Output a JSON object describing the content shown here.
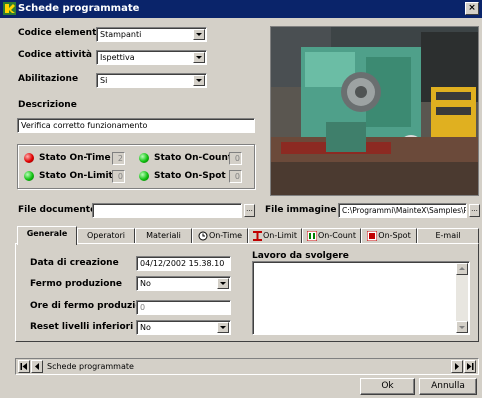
{
  "window": {
    "title": "Schede programmate",
    "close_glyph": "×"
  },
  "form": {
    "codice_elemento": {
      "label": "Codice elemento",
      "value": "Stampanti"
    },
    "codice_attivita": {
      "label": "Codice attività",
      "value": "Ispettiva"
    },
    "abilitazione": {
      "label": "Abilitazione",
      "value": "Si"
    },
    "descrizione": {
      "label": "Descrizione",
      "value": "Verifica corretto funzionamento"
    }
  },
  "status": {
    "on_time": {
      "label": "Stato On-Time",
      "value": "2",
      "led": "red"
    },
    "on_limit": {
      "label": "Stato On-Limit",
      "value": "0",
      "led": "green"
    },
    "on_count": {
      "label": "Stato On-Count",
      "value": "0",
      "led": "green"
    },
    "on_spot": {
      "label": "Stato On-Spot",
      "value": "0",
      "led": "green"
    }
  },
  "files": {
    "documento_label": "File documento",
    "documento_value": "",
    "immagine_label": "File immagine",
    "immagine_value": "C:\\Programmi\\MainteX\\Samples\\PIV.jpg",
    "browse_glyph": "..."
  },
  "tabs": [
    {
      "label": "Generale",
      "icon": "",
      "active": true
    },
    {
      "label": "Operatori",
      "icon": ""
    },
    {
      "label": "Materiali",
      "icon": ""
    },
    {
      "label": "On-Time",
      "icon": "clock-icon"
    },
    {
      "label": "On-Limit",
      "icon": "limit-icon"
    },
    {
      "label": "On-Count",
      "icon": "counter-icon"
    },
    {
      "label": "On-Spot",
      "icon": "spot-icon"
    },
    {
      "label": "E-mail",
      "icon": ""
    }
  ],
  "generale": {
    "data_creazione": {
      "label": "Data di creazione",
      "value": "04/12/2002 15.38.10"
    },
    "fermo_produzione": {
      "label": "Fermo produzione",
      "value": "No"
    },
    "ore_fermo": {
      "label": "Ore di fermo produzione",
      "value": "0"
    },
    "reset_livelli": {
      "label": "Reset livelli inferiori",
      "value": "No"
    },
    "lavoro_label": "Lavoro da svolgere",
    "lavoro_value": ""
  },
  "navigator": {
    "caption": "Schede programmate"
  },
  "buttons": {
    "ok": "Ok",
    "annulla": "Annulla"
  },
  "colors": {
    "titlebar": "#0a246a",
    "face": "#d4d0c8",
    "led_red": "#e00000",
    "led_green": "#10c010"
  }
}
